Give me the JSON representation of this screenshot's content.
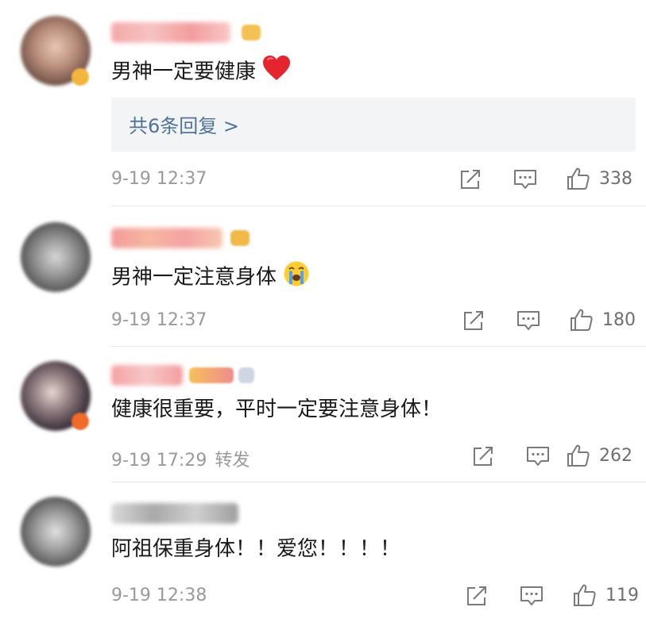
{
  "comments": [
    {
      "text": "男神一定要健康",
      "emoji": "heart-emoji",
      "reply_link": "共6条回复 >",
      "timestamp": "9-19 12:37",
      "likes": "338"
    },
    {
      "text": "男神一定注意身体",
      "emoji": "crying-face-emoji",
      "timestamp": "9-19 12:37",
      "likes": "180"
    },
    {
      "text": "健康很重要，平时一定要注意身体！",
      "timestamp": "9-19 17:29",
      "forward_label": "转发",
      "likes": "262"
    },
    {
      "text": "阿祖保重身体！！爱您！！！！",
      "timestamp": "9-19 12:38",
      "likes": "119"
    }
  ],
  "colors": {
    "link": "#50729e",
    "meta": "#9a9a9a",
    "reply_bg": "#f3f4f5",
    "divider": "#e6e6e6"
  }
}
